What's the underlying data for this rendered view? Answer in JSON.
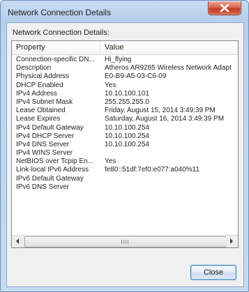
{
  "window": {
    "title": "Network Connection Details"
  },
  "dialog": {
    "section_label": "Network Connection Details:",
    "columns": {
      "property": "Property",
      "value": "Value"
    },
    "rows": [
      {
        "property": "Connection-specific DN...",
        "value": "Hi_flying"
      },
      {
        "property": "Description",
        "value": "Atheros AR9285 Wireless Network Adapt"
      },
      {
        "property": "Physical Address",
        "value": "E0-B9-A5-03-C6-09"
      },
      {
        "property": "DHCP Enabled",
        "value": "Yes"
      },
      {
        "property": "IPv4 Address",
        "value": "10.10.100.101"
      },
      {
        "property": "IPv4 Subnet Mask",
        "value": "255.255.255.0"
      },
      {
        "property": "Lease Obtained",
        "value": "Friday, August 15, 2014 3:49:39 PM"
      },
      {
        "property": "Lease Expires",
        "value": "Saturday, August 16, 2014 3:49:39 PM"
      },
      {
        "property": "IPv4 Default Gateway",
        "value": "10.10.100.254"
      },
      {
        "property": "IPv4 DHCP Server",
        "value": "10.10.100.254"
      },
      {
        "property": "IPv4 DNS Server",
        "value": "10.10.100.254"
      },
      {
        "property": "IPv4 WINS Server",
        "value": ""
      },
      {
        "property": "NetBIOS over Tcpip En...",
        "value": "Yes"
      },
      {
        "property": "Link-local IPv6 Address",
        "value": "fe80::51df:7ef0:e077:a040%11"
      },
      {
        "property": "IPv6 Default Gateway",
        "value": ""
      },
      {
        "property": "IPv6 DNS Server",
        "value": ""
      }
    ],
    "close_label": "Close"
  },
  "icons": {
    "close": "close-icon",
    "scroll_left": "arrow-left-icon",
    "scroll_right": "arrow-right-icon",
    "thumb_grip": "grip-icon"
  },
  "colors": {
    "frame": "#bcd3ee",
    "close_button_red": "#c43c22",
    "button_border": "#3c7fb1"
  }
}
